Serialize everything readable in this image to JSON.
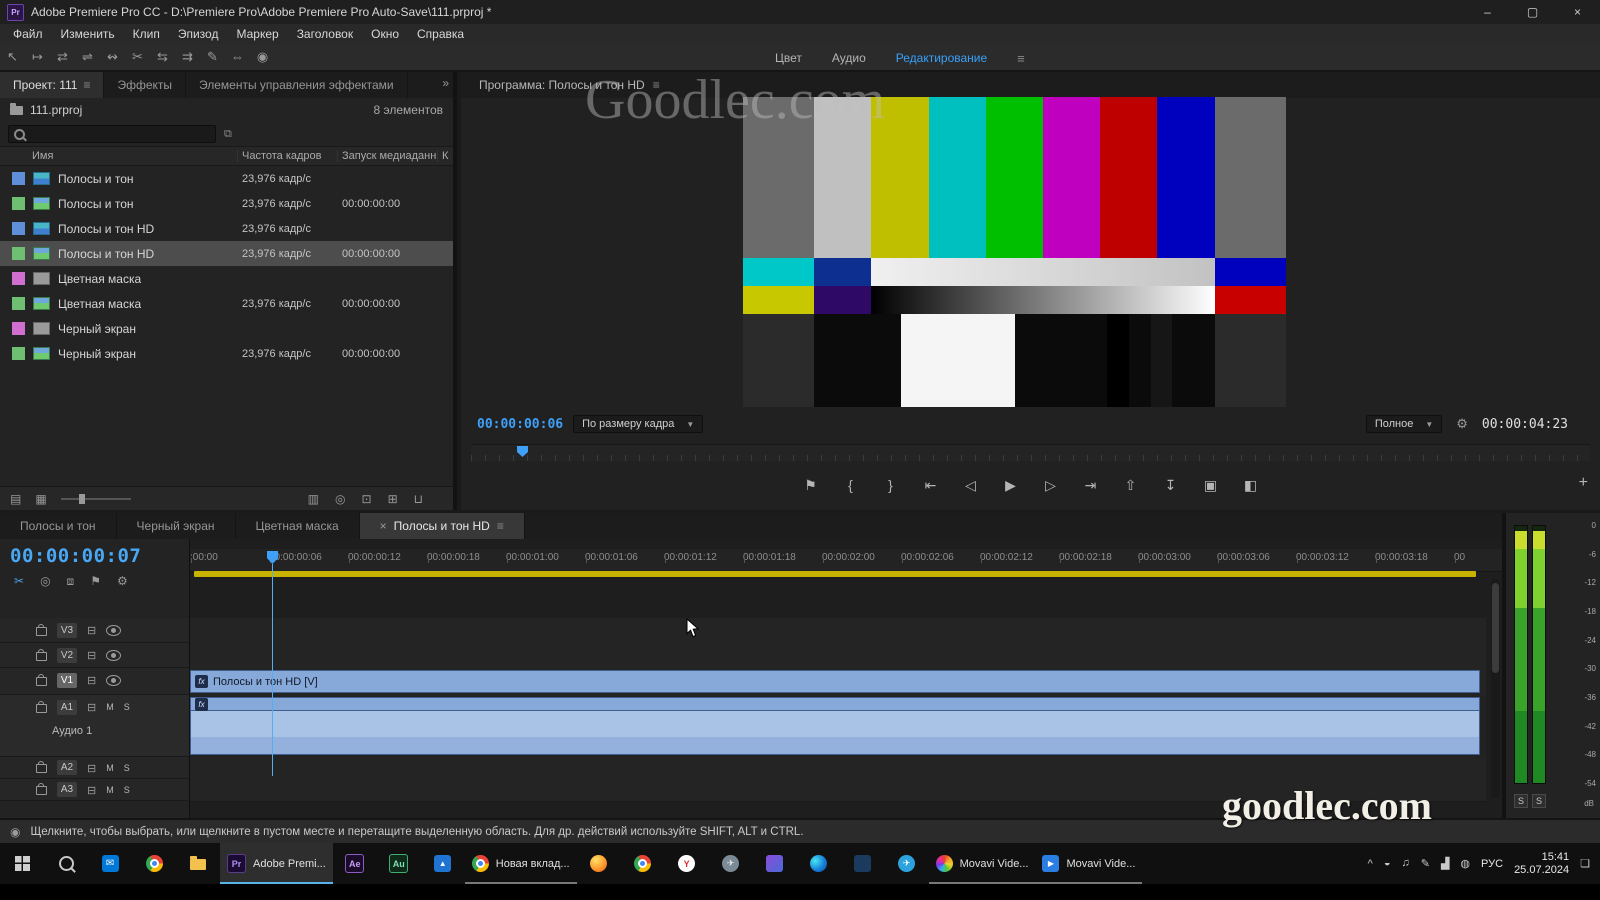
{
  "titlebar": {
    "app_badge": "Pr",
    "title": "Adobe Premiere Pro CC - D:\\Premiere Pro\\Adobe Premiere Pro Auto-Save\\111.prproj *",
    "controls": [
      {
        "name": "minimize-button",
        "glyph": "–"
      },
      {
        "name": "maximize-button",
        "glyph": "▢"
      },
      {
        "name": "close-button",
        "glyph": "×"
      }
    ]
  },
  "menubar": {
    "items": [
      "Файл",
      "Изменить",
      "Клип",
      "Эпизод",
      "Маркер",
      "Заголовок",
      "Окно",
      "Справка"
    ]
  },
  "toolbar": {
    "tools": [
      {
        "name": "selection-tool-icon",
        "glyph": "↖"
      },
      {
        "name": "track-select-tool-icon",
        "glyph": "↦"
      },
      {
        "name": "ripple-edit-tool-icon",
        "glyph": "⇄"
      },
      {
        "name": "rolling-edit-tool-icon",
        "glyph": "⇌"
      },
      {
        "name": "rate-stretch-tool-icon",
        "glyph": "↭"
      },
      {
        "name": "razor-tool-icon",
        "glyph": "✂"
      },
      {
        "name": "slip-tool-icon",
        "glyph": "⇆"
      },
      {
        "name": "slide-tool-icon",
        "glyph": "⇉"
      },
      {
        "name": "pen-tool-icon",
        "glyph": "✎"
      },
      {
        "name": "hand-tool-icon",
        "glyph": "⇔"
      },
      {
        "name": "zoom-tool-icon",
        "glyph": "◉"
      }
    ],
    "workspaces": [
      {
        "label": "Цвет",
        "state": ""
      },
      {
        "label": "Аудио",
        "state": ""
      },
      {
        "label": "Редактирование",
        "state": "active"
      }
    ],
    "workspace_menu_icon": "≡"
  },
  "project": {
    "tabs": [
      {
        "label": "Проект: 111",
        "state": "active",
        "menu": "≡"
      },
      {
        "label": "Эффекты",
        "state": ""
      },
      {
        "label": "Элементы управления эффектами",
        "state": ""
      }
    ],
    "overflow_chevron": "»",
    "bin_name": "111.prproj",
    "item_count": "8 элементов",
    "inout_icon": "⧉",
    "columns": {
      "name": "Имя",
      "fps": "Частота кадров",
      "start": "Запуск медиаданн",
      "extra": "К"
    },
    "rows": [
      {
        "chip": "#5f8fd9",
        "kind": "sequence-icon",
        "name": "Полосы и тон",
        "fps": "23,976 кадр/с",
        "start": "",
        "state": ""
      },
      {
        "chip": "#6fbf73",
        "kind": "clip-icon",
        "name": "Полосы и тон",
        "fps": "23,976 кадр/с",
        "start": "00:00:00:00",
        "state": ""
      },
      {
        "chip": "#5f8fd9",
        "kind": "sequence-icon",
        "name": "Полосы и тон HD",
        "fps": "23,976 кадр/с",
        "start": "",
        "state": ""
      },
      {
        "chip": "#6fbf73",
        "kind": "clip-icon",
        "name": "Полосы и тон HD",
        "fps": "23,976 кадр/с",
        "start": "00:00:00:00",
        "state": "selected"
      },
      {
        "chip": "#d06fd0",
        "kind": "matte-icon",
        "name": "Цветная маска",
        "fps": "",
        "start": "",
        "state": ""
      },
      {
        "chip": "#6fbf73",
        "kind": "clip-icon",
        "name": "Цветная маска",
        "fps": "23,976 кадр/с",
        "start": "00:00:00:00",
        "state": ""
      },
      {
        "chip": "#d06fd0",
        "kind": "matte-icon",
        "name": "Черный экран",
        "fps": "",
        "start": "",
        "state": ""
      },
      {
        "chip": "#6fbf73",
        "kind": "clip-icon",
        "name": "Черный экран",
        "fps": "23,976 кадр/с",
        "start": "00:00:00:00",
        "state": ""
      }
    ],
    "footer_left": [
      {
        "name": "list-view-icon",
        "glyph": "▤"
      },
      {
        "name": "icon-view-icon",
        "glyph": "▦"
      }
    ],
    "footer_right": [
      {
        "name": "automate-to-sequence-icon",
        "glyph": "▥"
      },
      {
        "name": "find-icon",
        "glyph": "◎"
      },
      {
        "name": "new-bin-icon",
        "glyph": "⊡"
      },
      {
        "name": "new-item-icon",
        "glyph": "⊞"
      },
      {
        "name": "trash-icon",
        "glyph": "⊔"
      }
    ]
  },
  "program": {
    "title": "Программа: Полосы и тон HD",
    "menu_icon": "≡",
    "current_time": "00:00:00:06",
    "fit_dropdown": "По размеру кадра",
    "quality_dropdown": "Полное",
    "dropdown_arrow": "▼",
    "settings_icon": "⚙",
    "duration": "00:00:04:23",
    "add_button": "+",
    "transport": [
      {
        "name": "add-marker-icon",
        "glyph": "⚑"
      },
      {
        "name": "mark-in-icon",
        "glyph": "{"
      },
      {
        "name": "mark-out-icon",
        "glyph": "}"
      },
      {
        "name": "go-to-in-icon",
        "glyph": "⇤"
      },
      {
        "name": "step-back-icon",
        "glyph": "◁"
      },
      {
        "name": "play-icon",
        "glyph": "▶"
      },
      {
        "name": "step-forward-icon",
        "glyph": "▷"
      },
      {
        "name": "go-to-out-icon",
        "glyph": "⇥"
      },
      {
        "name": "lift-icon",
        "glyph": "⇧"
      },
      {
        "name": "extract-icon",
        "glyph": "↧"
      },
      {
        "name": "export-frame-icon",
        "glyph": "▣"
      },
      {
        "name": "comparison-view-icon",
        "glyph": "◧"
      }
    ]
  },
  "timeline": {
    "tabs": [
      {
        "label": "Полосы и тон",
        "state": ""
      },
      {
        "label": "Черный экран",
        "state": ""
      },
      {
        "label": "Цветная маска",
        "state": ""
      },
      {
        "label": "Полосы и тон HD",
        "state": "active",
        "close": "×",
        "menu": "≡"
      }
    ],
    "current_time": "00:00:00:07",
    "tools": [
      {
        "name": "razor-icon",
        "glyph": "✂"
      },
      {
        "name": "snap-icon",
        "glyph": "◎"
      },
      {
        "name": "linked-selection-icon",
        "glyph": "⧈"
      },
      {
        "name": "add-marker-icon",
        "glyph": "⚑"
      },
      {
        "name": "timeline-settings-icon",
        "glyph": "⚙"
      }
    ],
    "ruler_labels": [
      ":00:00",
      "00:00:00:06",
      "00:00:00:12",
      "00:00:00:18",
      "00:00:01:00",
      "00:00:01:06",
      "00:00:01:12",
      "00:00:01:18",
      "00:00:02:00",
      "00:00:02:06",
      "00:00:02:12",
      "00:00:02:18",
      "00:00:03:00",
      "00:00:03:06",
      "00:00:03:12",
      "00:00:03:18",
      "00"
    ],
    "video_tracks": [
      {
        "label": "V3",
        "state": ""
      },
      {
        "label": "V2",
        "state": ""
      },
      {
        "label": "V1",
        "state": "targeted"
      }
    ],
    "audio_tracks": [
      {
        "label": "A1",
        "state": "targeted",
        "size": "tall",
        "sub": "Аудио 1"
      },
      {
        "label": "A2",
        "state": "",
        "size": "",
        "sub": ""
      },
      {
        "label": "A3",
        "state": "",
        "size": "",
        "sub": ""
      }
    ],
    "mute_label": "M",
    "solo_label": "S",
    "video_clip_label": "Полосы и тон HD [V]",
    "fx_badge": "fx"
  },
  "meter": {
    "scale": [
      "0",
      "-6",
      "-12",
      "-18",
      "-24",
      "-30",
      "-36",
      "-42",
      "-48",
      "-54"
    ],
    "db_label": "dB",
    "solos": [
      "S",
      "S"
    ]
  },
  "status": {
    "text": "Щелкните, чтобы выбрать, или щелкните в пустом месте и перетащите выделенную область. Для др. действий используйте SHIFT, ALT и CTRL."
  },
  "taskbar": {
    "items": [
      {
        "name": "start-button",
        "icon": "i-start",
        "badge": "",
        "label": "",
        "state": ""
      },
      {
        "name": "search-button",
        "icon": "i-search",
        "badge": "",
        "label": "",
        "state": ""
      },
      {
        "name": "mail-icon",
        "icon": "i-mail",
        "badge": "",
        "label": "",
        "state": ""
      },
      {
        "name": "browser-icon",
        "icon": "i-chrome",
        "badge": "",
        "label": "",
        "state": ""
      },
      {
        "name": "file-explorer-icon",
        "icon": "i-explorer",
        "badge": "",
        "label": "",
        "state": ""
      },
      {
        "name": "premiere-taskbar-item",
        "icon": "i-premiere",
        "badge": "Pr",
        "label": "Adobe Premi...",
        "state": "active"
      },
      {
        "name": "after-effects-icon",
        "icon": "i-ae",
        "badge": "Ae",
        "label": "",
        "state": ""
      },
      {
        "name": "audition-icon",
        "icon": "i-au",
        "badge": "Au",
        "label": "",
        "state": ""
      },
      {
        "name": "photos-icon",
        "icon": "i-photos",
        "badge": "",
        "label": "",
        "state": ""
      },
      {
        "name": "chrome-taskbar-item",
        "icon": "i-chrome",
        "badge": "",
        "label": "Новая вклад...",
        "state": "open"
      },
      {
        "name": "firefox-icon",
        "icon": "i-firefox",
        "badge": "",
        "label": "",
        "state": ""
      },
      {
        "name": "chrome-icon",
        "icon": "i-chrome",
        "badge": "",
        "label": "",
        "state": ""
      },
      {
        "name": "yandex-icon",
        "icon": "i-yandex",
        "badge": "Y",
        "label": "",
        "state": ""
      },
      {
        "name": "app-icon",
        "icon": "i-plane",
        "badge": "",
        "label": "",
        "state": ""
      },
      {
        "name": "app-icon",
        "icon": "i-app1",
        "badge": "",
        "label": "",
        "state": ""
      },
      {
        "name": "edge-icon",
        "icon": "i-edge",
        "badge": "",
        "label": "",
        "state": ""
      },
      {
        "name": "app-icon",
        "icon": "i-app2",
        "badge": "",
        "label": "",
        "state": ""
      },
      {
        "name": "telegram-icon",
        "icon": "i-telegram",
        "badge": "",
        "label": "",
        "state": ""
      },
      {
        "name": "movavi-taskbar-item",
        "icon": "i-movavi",
        "badge": "",
        "label": "Movavi Vide...",
        "state": "open"
      },
      {
        "name": "movavi-taskbar-item",
        "icon": "i-movavi2",
        "badge": "",
        "label": "Movavi Vide...",
        "state": "open"
      }
    ],
    "tray": {
      "chevron": "^",
      "icons": [
        {
          "name": "antivirus-tray-icon",
          "glyph": "◒"
        },
        {
          "name": "volume-icon",
          "glyph": "♫"
        },
        {
          "name": "input-pen-icon",
          "glyph": "✎"
        },
        {
          "name": "network-icon",
          "glyph": "▟"
        },
        {
          "name": "browser-tray-icon",
          "glyph": "◍"
        }
      ],
      "language": "РУС",
      "time": "15:41",
      "date": "25.07.2024",
      "notification": "❏"
    }
  },
  "watermark": {
    "top": "Goodlec.com",
    "bottom": "goodlec.com"
  },
  "colors": {
    "accent_blue": "#38a0f8",
    "timecode_blue": "#49a8f5",
    "clip_blue": "#87a9d9",
    "workarea_yellow": "#c8b400"
  }
}
